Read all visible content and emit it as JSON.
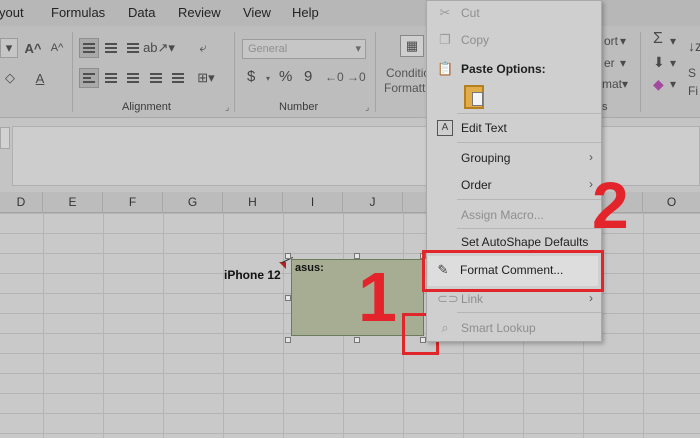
{
  "ribbon": {
    "tabs": [
      "yout",
      "Formulas",
      "Data",
      "Review",
      "View",
      "Help"
    ],
    "group_labels": {
      "alignment": "Alignment",
      "number": "Number"
    },
    "number_format": "General",
    "number_symbols": [
      "$",
      "%",
      "9"
    ],
    "font_size_controls": [
      "A^",
      "A^"
    ],
    "conditional_formatting": [
      "Conditio",
      "Formatti"
    ],
    "right_fragments": [
      "ort",
      "er",
      "mat",
      "s",
      "S",
      "Fi"
    ]
  },
  "columns": [
    "D",
    "E",
    "F",
    "G",
    "H",
    "I",
    "J",
    "O"
  ],
  "cells": {
    "h_value": "iPhone 12"
  },
  "comment": {
    "author": "asus:"
  },
  "callouts": {
    "step1": "1",
    "step2": "2"
  },
  "context_menu": {
    "items": [
      {
        "label": "Cut",
        "icon": "scissors-icon",
        "disabled": true
      },
      {
        "label": "Copy",
        "icon": "copy-icon",
        "disabled": true
      },
      {
        "label": "Paste Options:",
        "icon": "paste-icon",
        "bold": true
      },
      {
        "label": "Edit Text",
        "icon": "edit-text-icon"
      },
      {
        "label": "Grouping",
        "submenu": true
      },
      {
        "label": "Order",
        "submenu": true
      },
      {
        "label": "Assign Macro...",
        "disabled": true
      },
      {
        "label": "Set AutoShape Defaults"
      },
      {
        "label": "Format Comment...",
        "icon": "format-shape-icon",
        "highlighted": true
      },
      {
        "label": "Link",
        "icon": "link-icon",
        "disabled": true,
        "submenu": true
      },
      {
        "label": "Smart Lookup",
        "icon": "search-icon",
        "disabled": true
      }
    ]
  },
  "colors": {
    "callout_red": "#e3242b",
    "comment_fill": "#a7ad93"
  }
}
